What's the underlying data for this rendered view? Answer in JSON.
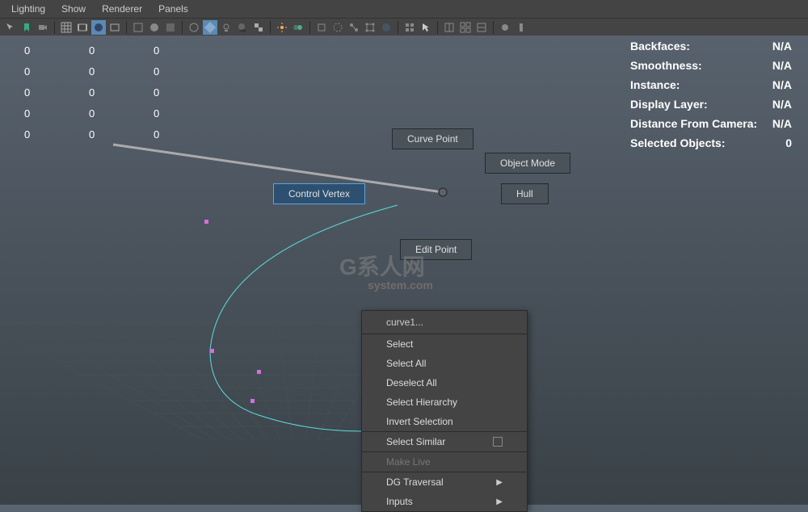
{
  "menubar": {
    "items": [
      "Lighting",
      "Show",
      "Renderer",
      "Panels"
    ]
  },
  "data_table": {
    "rows": [
      [
        "0",
        "0",
        "0"
      ],
      [
        "0",
        "0",
        "0"
      ],
      [
        "0",
        "0",
        "0"
      ],
      [
        "0",
        "0",
        "0"
      ],
      [
        "0",
        "0",
        "0"
      ]
    ]
  },
  "info_panel": {
    "rows": [
      {
        "label": "Backfaces:",
        "value": "N/A"
      },
      {
        "label": "Smoothness:",
        "value": "N/A"
      },
      {
        "label": "Instance:",
        "value": "N/A"
      },
      {
        "label": "Display Layer:",
        "value": "N/A"
      },
      {
        "label": "Distance From Camera:",
        "value": "N/A"
      },
      {
        "label": "Selected Objects:",
        "value": "0"
      }
    ]
  },
  "marking_menu": {
    "curve_point": "Curve Point",
    "object_mode": "Object Mode",
    "control_vertex": "Control Vertex",
    "hull": "Hull",
    "edit_point": "Edit Point"
  },
  "context_menu": {
    "title": "curve1...",
    "items": [
      {
        "label": "Select",
        "type": "item"
      },
      {
        "label": "Select All",
        "type": "item"
      },
      {
        "label": "Deselect All",
        "type": "item"
      },
      {
        "label": "Select Hierarchy",
        "type": "item"
      },
      {
        "label": "Invert Selection",
        "type": "item"
      },
      {
        "label": "Select Similar",
        "type": "checkbox"
      },
      {
        "label": "Make Live",
        "type": "disabled"
      },
      {
        "label": "DG Traversal",
        "type": "submenu"
      },
      {
        "label": "Inputs",
        "type": "submenu"
      }
    ]
  },
  "watermark": {
    "main": "G系人网",
    "sub": "system.com"
  }
}
